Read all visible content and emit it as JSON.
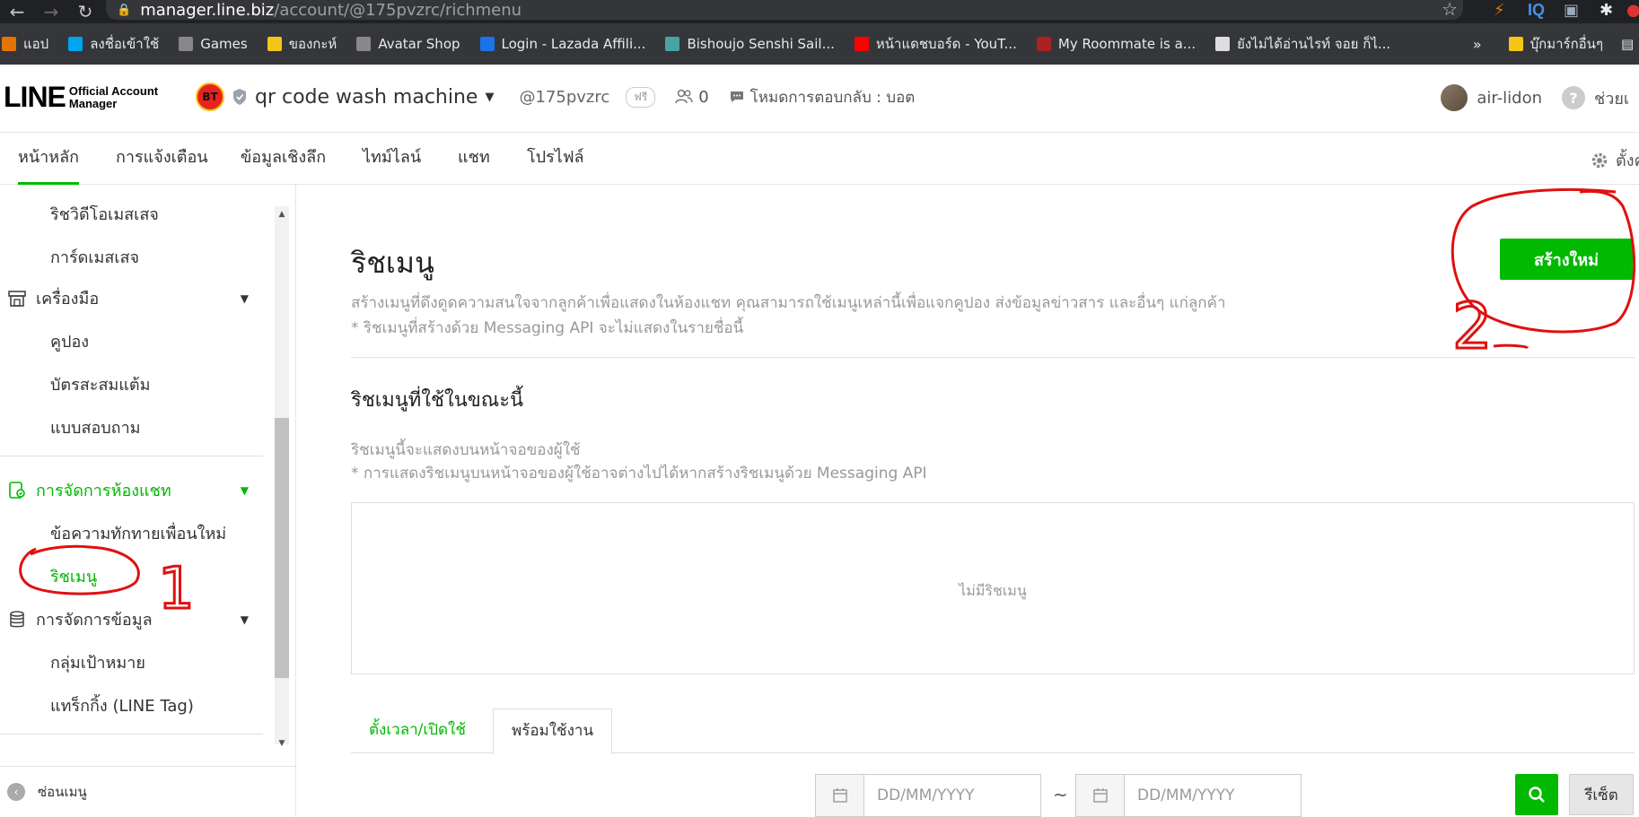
{
  "browser": {
    "url_host": "manager.line.biz",
    "url_path": "/account/@175pvzrc/richmenu",
    "bookmarks": [
      {
        "label": "แอป",
        "icon": "apps-grid-icon",
        "color": "#e37400"
      },
      {
        "label": "ลงชื่อเข้าใช้",
        "icon": "microsoft-icon",
        "color": "#00a4ef"
      },
      {
        "label": "Games",
        "icon": "game-bookmark-icon",
        "color": "#888888"
      },
      {
        "label": "ของกะห์",
        "icon": "folder-icon",
        "color": "#f5c518"
      },
      {
        "label": "Avatar Shop",
        "icon": "roblox-icon",
        "color": "#888888"
      },
      {
        "label": "Login - Lazada Affili...",
        "icon": "lazada-icon",
        "color": "#1a73e8"
      },
      {
        "label": "Bishoujo Senshi Sail...",
        "icon": "site-icon",
        "color": "#4aa3a3"
      },
      {
        "label": "หน้าแดชบอร์ด - YouT...",
        "icon": "youtube-icon",
        "color": "#ff0000"
      },
      {
        "label": "My Roommate is a...",
        "icon": "manga-icon",
        "color": "#aa2222"
      },
      {
        "label": "ยังไม่ได้อ่านไรท์ จอย ก็ไ...",
        "icon": "globe-icon",
        "color": "#dddddd"
      }
    ],
    "overflow": "»",
    "other_bookmarks": "บุ๊กมาร์กอื่นๆ"
  },
  "header": {
    "logo_big": "LINE",
    "logo_small_1": "Official Account",
    "logo_small_2": "Manager",
    "account_badge": "BT",
    "account_name": "qr code wash machine",
    "handle": "@175pvzrc",
    "plan": "ฟรี",
    "friends": "0",
    "reply_mode": "โหมดการตอบกลับ : บอต",
    "user_name": "air-lidon",
    "help": "ช่วยเ"
  },
  "tabs": [
    {
      "label": "หน้าหลัก",
      "active": true
    },
    {
      "label": "การแจ้งเตือน",
      "active": false
    },
    {
      "label": "ข้อมูลเชิงลึก",
      "active": false
    },
    {
      "label": "ไทม์ไลน์",
      "active": false
    },
    {
      "label": "แชท",
      "active": false
    },
    {
      "label": "โปรไฟล์",
      "active": false
    }
  ],
  "settings_label": "ตั้งค",
  "sidebar": {
    "items_top": [
      "ริชวิดีโอเมสเสจ",
      "การ์ดเมสเสจ"
    ],
    "group_tools": "เครื่องมือ",
    "tools_items": [
      "คูปอง",
      "บัตรสะสมแต้ม",
      "แบบสอบถาม"
    ],
    "group_chat": "การจัดการห้องแชท",
    "chat_items": [
      "ข้อความทักทายเพื่อนใหม่",
      "ริชเมนู"
    ],
    "group_data": "การจัดการข้อมูล",
    "data_items": [
      "กลุ่มเป้าหมาย",
      "แทร็กกิ้ง (LINE Tag)"
    ],
    "hide_menu": "ซ่อนเมนู"
  },
  "main": {
    "title": "ริชเมนู",
    "create_button": "สร้างใหม่",
    "desc1": "สร้างเมนูที่ดึงดูดความสนใจจากลูกค้าเพื่อแสดงในห้องแชท คุณสามารถใช้เมนูเหล่านี้เพื่อแจกคูปอง ส่งข้อมูลข่าวสาร และอื่นๆ แก่ลูกค้า",
    "desc2": "* ริชเมนูที่สร้างด้วย Messaging API จะไม่แสดงในรายชื่อนี้",
    "current_title": "ริชเมนูที่ใช้ในขณะนี้",
    "note1": "ริชเมนูนี้จะแสดงบนหน้าจอของผู้ใช้",
    "note2": "* การแสดงริชเมนูบนหน้าจอของผู้ใช้อาจต่างไปได้หากสร้างริชเมนูด้วย Messaging API",
    "empty": "ไม่มีริชเมนู",
    "tab_scheduled": "ตั้งเวลา/เปิดใช้",
    "tab_ready": "พร้อมใช้งาน",
    "date_placeholder": "DD/MM/YYYY",
    "tilde": "~",
    "reset": "รีเซ็ต"
  },
  "annotations": {
    "one": "1",
    "two": "2",
    "color": "#e01010"
  },
  "colors": {
    "accent": "#00b900",
    "chrome_dark": "#202124",
    "bookmark_bar": "#35363a"
  }
}
